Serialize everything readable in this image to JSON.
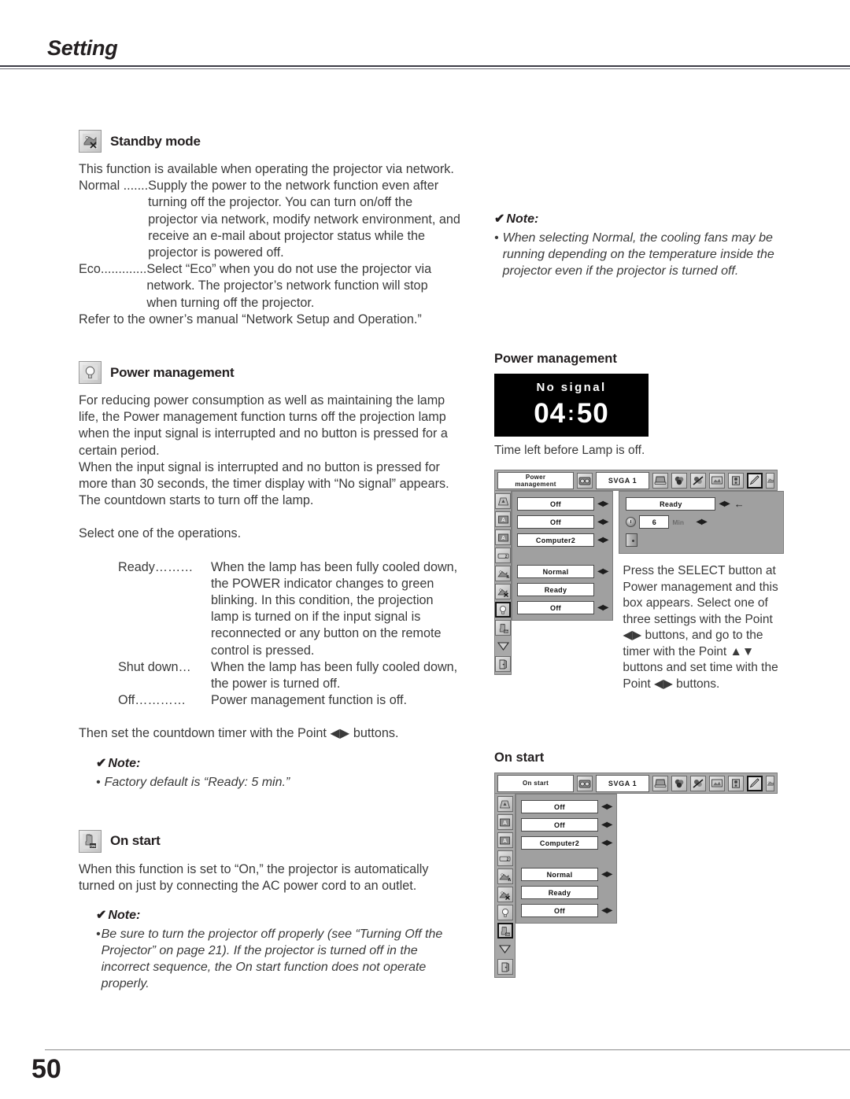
{
  "header": {
    "title": "Setting"
  },
  "footer": {
    "page_number": "50"
  },
  "sections": {
    "standby": {
      "icon": "standby-mode-icon",
      "title": "Standby mode",
      "intro": "This function is available when operating the projector via network.",
      "normal_term": "Normal .......",
      "normal_desc": "Supply the power to the network function even after turning off the projector. You can turn on/off the projector via network, modify network environment, and receive an e-mail about projector status while the projector is powered off.",
      "eco_term": "Eco.............",
      "eco_desc": "Select “Eco” when you do not use the projector via network. The projector’s network function will stop when turning off the projector.",
      "refer": "Refer to the owner’s manual “Network Setup and Operation.”",
      "note_title": "Note:",
      "note_check": "✔",
      "note_bullet": "•",
      "note_text": "When selecting Normal, the cooling fans may be running depending on the temperature inside the projector even if the projector is turned off."
    },
    "power_management": {
      "icon": "lamp-icon",
      "title": "Power management",
      "para1": "For reducing power consumption as well as maintaining the lamp life, the Power management function turns off the projection lamp when the input signal is interrupted and no button is pressed for a certain period.",
      "para2": "When the input signal is interrupted and no button is pressed for more than 30 seconds, the timer display with “No signal” appears. The countdown starts to turn off the lamp.",
      "para3": "Select one of the operations.",
      "options": [
        {
          "term": "Ready………",
          "desc": "When the lamp has been fully cooled down, the POWER indicator changes to green blinking. In this condition, the projection lamp is turned on if the input signal is reconnected or any button on the remote control is pressed."
        },
        {
          "term": "Shut down…",
          "desc": "When the lamp has been fully cooled down, the power is turned off."
        },
        {
          "term": "Off…………",
          "desc": " Power management function is off."
        }
      ],
      "para4_a": "Then set the countdown timer with the Point ",
      "para4_arrows": "◀▶",
      "para4_b": " buttons.",
      "note_title": "Note:",
      "note_check": "✔",
      "note_bullet": "•",
      "note_text": "Factory default is “Ready: 5 min.”"
    },
    "on_start": {
      "icon": "on-start-icon",
      "title": "On start",
      "para1": "When this function is set to “On,” the projector is automatically turned on just by connecting the AC power cord to an outlet.",
      "note_title": "Note:",
      "note_check": "✔",
      "note_bullet": "•",
      "note_text": "Be sure to turn the projector off properly (see “Turning Off the Projector” on page 21). If the projector is turned off in the incorrect sequence, the On start function does not operate properly."
    }
  },
  "right_column": {
    "power_management": {
      "title": "Power management",
      "osd_display": {
        "no_signal_label": "No signal",
        "minutes": "04",
        "colon": ":",
        "seconds": "50"
      },
      "caption": "Time left before Lamp is off.",
      "menu": {
        "menu_name_line1": "Power",
        "menu_name_line2": "management",
        "source": "SVGA 1",
        "rows": [
          {
            "value": "Off",
            "arrows": "◀▶"
          },
          {
            "value": "Off",
            "arrows": "◀▶"
          },
          {
            "value": "Computer2",
            "arrows": "◀▶"
          },
          {
            "value": "Normal",
            "arrows": "◀▶"
          },
          {
            "value": "Ready",
            "arrows": ""
          },
          {
            "value": "Off",
            "arrows": "◀▶"
          }
        ],
        "popup": {
          "mode_value": "Ready",
          "mode_arrows": "◀▶",
          "return_arrow": "←",
          "timer_value": "6",
          "timer_unit": "Min",
          "timer_arrows": "◀▶"
        }
      },
      "description_a": "Press the SELECT button at Power management and this box appears.  Select one of three settings with the Point ",
      "description_arrows1": "◀▶",
      "description_b": " buttons, and go to the timer with the Point ",
      "description_arrows2": "▲▼",
      "description_c": " buttons and set time with the Point ",
      "description_arrows3": "◀▶",
      "description_d": " buttons."
    },
    "on_start": {
      "title": "On start",
      "menu": {
        "menu_name": "On start",
        "source": "SVGA 1",
        "rows": [
          {
            "value": "Off",
            "arrows": "◀▶"
          },
          {
            "value": "Off",
            "arrows": "◀▶"
          },
          {
            "value": "Computer2",
            "arrows": "◀▶"
          },
          {
            "value": "Normal",
            "arrows": "◀▶"
          },
          {
            "value": "Ready",
            "arrows": ""
          },
          {
            "value": "Off",
            "arrows": "◀▶"
          }
        ]
      }
    }
  },
  "colors": {
    "text": "#3a3a3a",
    "heading": "#231f20",
    "osd_bg": "#a0a0a0",
    "osd_bar": "#a8a8a8",
    "display_bg": "#000000"
  }
}
